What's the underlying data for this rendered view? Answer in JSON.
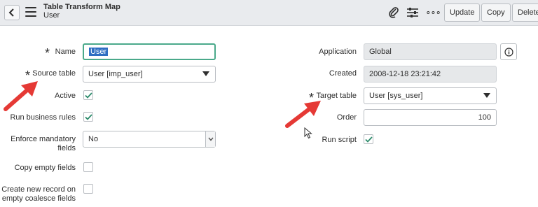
{
  "header": {
    "title": "Table Transform Map",
    "subtitle": "User",
    "update_label": "Update",
    "copy_label": "Copy",
    "delete_label": "Delete",
    "more_icon": "∘∘∘"
  },
  "form": {
    "name": {
      "label": "Name",
      "value": "User"
    },
    "source_table": {
      "label": "Source table",
      "value": "User [imp_user]"
    },
    "active": {
      "label": "Active",
      "checked": true
    },
    "run_business_rules": {
      "label": "Run business rules",
      "checked": true
    },
    "enforce_mandatory": {
      "label_line1": "Enforce mandatory",
      "label_line2": "fields",
      "value": "No"
    },
    "copy_empty": {
      "label": "Copy empty fields",
      "checked": false
    },
    "create_new_record": {
      "label_line1": "Create new record on",
      "label_line2": "empty coalesce fields",
      "checked": false
    },
    "application": {
      "label": "Application",
      "value": "Global"
    },
    "created": {
      "label": "Created",
      "value": "2008-12-18 23:21:42"
    },
    "target_table": {
      "label": "Target table",
      "value": "User [sys_user]"
    },
    "order": {
      "label": "Order",
      "value": "100"
    },
    "run_script": {
      "label": "Run script",
      "checked": true
    }
  },
  "colors": {
    "accent": "#4aa98a",
    "check": "#2b8a6a",
    "arrow": "#e53935"
  }
}
